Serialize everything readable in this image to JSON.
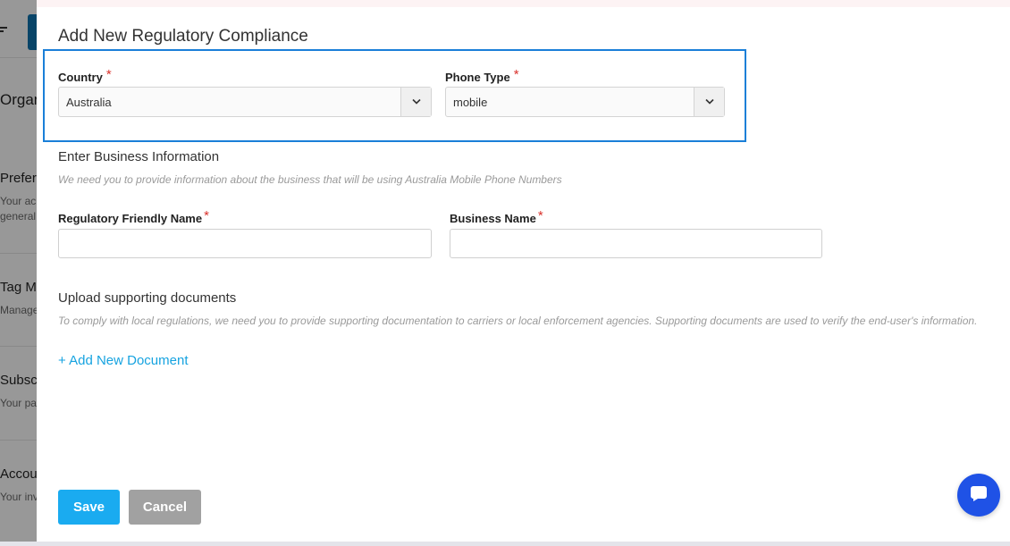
{
  "background": {
    "items": [
      {
        "title": "Organ",
        "sub": ""
      },
      {
        "title": "Prefer",
        "sub": "Your ac",
        "sub2": "general"
      },
      {
        "title": "Tag Ma",
        "sub": "Manage"
      },
      {
        "title": "Subscr",
        "sub": "Your pa"
      },
      {
        "title": "Accou",
        "sub": "Your inv"
      }
    ]
  },
  "modal": {
    "title": "Add New Regulatory Compliance",
    "country": {
      "label": "Country",
      "required": "*",
      "value": "Australia"
    },
    "phone_type": {
      "label": "Phone Type",
      "required": "*",
      "value": "mobile"
    },
    "business_section": {
      "title": "Enter Business Information",
      "description": "We need you to provide information about the business that will be using Australia Mobile Phone Numbers"
    },
    "friendly_name": {
      "label": "Regulatory Friendly Name",
      "required": "*",
      "value": ""
    },
    "business_name": {
      "label": "Business Name",
      "required": "*",
      "value": ""
    },
    "upload_section": {
      "title": "Upload supporting documents",
      "description": "To comply with local regulations, we need you to provide supporting documentation to carriers or local enforcement agencies. Supporting documents are used to verify the end-user's information."
    },
    "add_document_label": "+ Add New Document",
    "save_label": "Save",
    "cancel_label": "Cancel"
  },
  "icons": {
    "select_arrow": "chevron-down-icon",
    "chat": "chat-bubble-icon",
    "menu": "filter-menu-icon"
  },
  "colors": {
    "primary": "#1aabf0",
    "link": "#16a3e0",
    "required": "#d9322c",
    "highlight": "#1a7fd8",
    "chat": "#1f52e6",
    "cancel": "#a1a1a1"
  }
}
